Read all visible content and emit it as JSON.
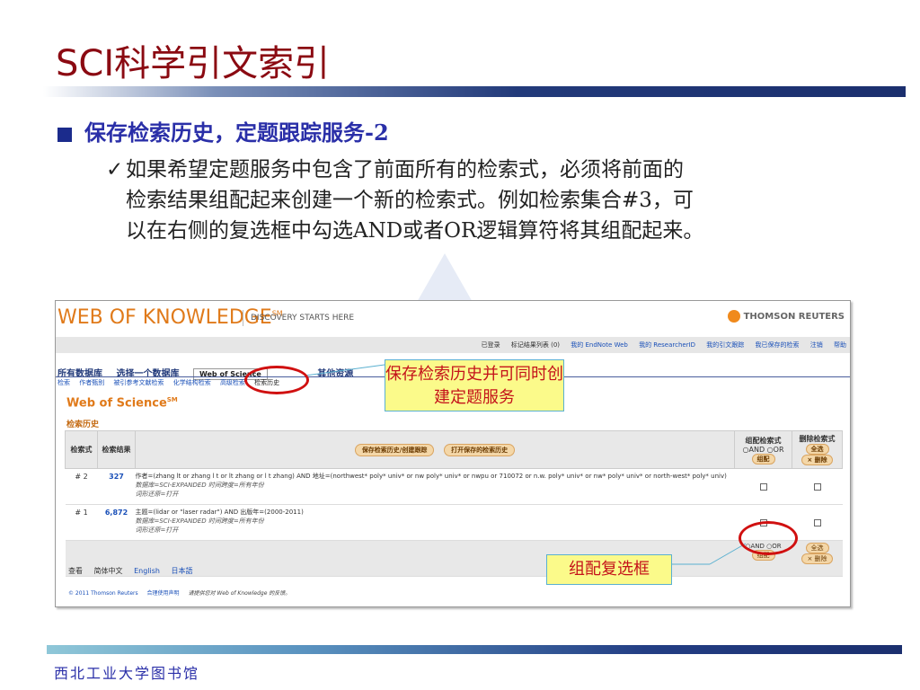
{
  "slide": {
    "title": "SCI科学引文索引",
    "bullet": "保存检索历史，定题跟踪服务-2",
    "checkmark": "✓",
    "paragraph_line1": "如果希望定题服务中包含了前面所有的检索式，必须将前面的",
    "paragraph_line2": "检索结果组配起来创建一个新的检索式。例如检索集合#3，可",
    "paragraph_line3": "以在右侧的复选框中勾选AND或者OR逻辑算符将其组配起来。",
    "footer": "西北工业大学图书馆",
    "title_color": "#8b0a12",
    "accent_color": "#1b2f6e"
  },
  "screenshot": {
    "logo": "WEB OF KNOWLEDGE",
    "logo_sm": "SM",
    "tagline": "DISCOVERY STARTS HERE",
    "brand": "THOMSON REUTERS",
    "topnav": [
      "已登录",
      "标记结果列表 (0)",
      "我的 EndNote Web",
      "我的 ResearcherID",
      "我的引文跟踪",
      "我已保存的检索",
      "注销",
      "帮助"
    ],
    "tabs": [
      "所有数据库",
      "选择一个数据库",
      "Web of Science",
      "其他资源"
    ],
    "subtabs": [
      "检索",
      "作者甄别",
      "被引参考文献检索",
      "化学结构检索",
      "高级检索",
      "检索历史"
    ],
    "db_title": "Web of Science",
    "db_title_sm": "SM",
    "section": "检索历史",
    "col_set": "检索式",
    "col_results": "检索结果",
    "btn_save": "保存检索历史/创建跟踪",
    "btn_open": "打开保存的检索历史",
    "col_combine": "组配检索式",
    "opt_and": "AND",
    "opt_or": "OR",
    "btn_combine": "组配",
    "col_delete": "删除检索式",
    "btn_select_all": "全选",
    "btn_delete": "× 删除",
    "rows": [
      {
        "set": "# 2",
        "count": "327",
        "query": "作者=(zhang lt or zhang l t or lt zhang or l t zhang) AND 地址=(northwest* poly* univ* or nw poly* univ* or nwpu or 710072 or n.w. poly* univ* or nw* poly* univ* or north-west* poly* univ)",
        "db": "数据库=SCI-EXPANDED 时间跨度=所有年份",
        "lemma": "词形还原=打开"
      },
      {
        "set": "# 1",
        "count": "6,872",
        "query": "主题=(lidar or \"laser radar\") AND 出版年=(2000-2011)",
        "db": "数据库=SCI-EXPANDED 时间跨度=所有年份",
        "lemma": "词形还原=打开"
      }
    ],
    "view_label": "查看",
    "lang_zh": "简体中文",
    "lang_en": "English",
    "lang_ja": "日本語",
    "copyright": "© 2011 Thomson Reuters",
    "terms": "合理使用声明",
    "feedback": "请提供您对 Web of Knowledge 的反馈。"
  },
  "callouts": {
    "save_history": "保存检索历史并可同时创建定题服务",
    "combine_box": "组配复选框"
  }
}
